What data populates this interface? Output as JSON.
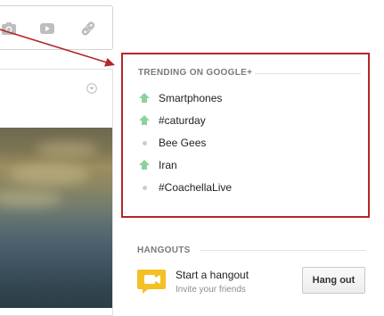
{
  "share_toolbar": {
    "icons": [
      "camera-icon",
      "video-icon",
      "link-icon"
    ]
  },
  "trending": {
    "title": "TRENDING ON GOOGLE+",
    "items": [
      {
        "label": "Smartphones",
        "indicator": "up-arrow-icon"
      },
      {
        "label": "#caturday",
        "indicator": "up-arrow-icon"
      },
      {
        "label": "Bee Gees",
        "indicator": "dot-icon"
      },
      {
        "label": "Iran",
        "indicator": "up-arrow-icon"
      },
      {
        "label": "#CoachellaLive",
        "indicator": "dot-icon"
      }
    ]
  },
  "hangouts": {
    "title": "HANGOUTS",
    "start_label": "Start a hangout",
    "invite_label": "Invite your friends",
    "button_label": "Hang out"
  },
  "colors": {
    "highlight_border": "#b5262a",
    "trend_up": "#8fd19e",
    "hangout_icon": "#f3c025"
  }
}
